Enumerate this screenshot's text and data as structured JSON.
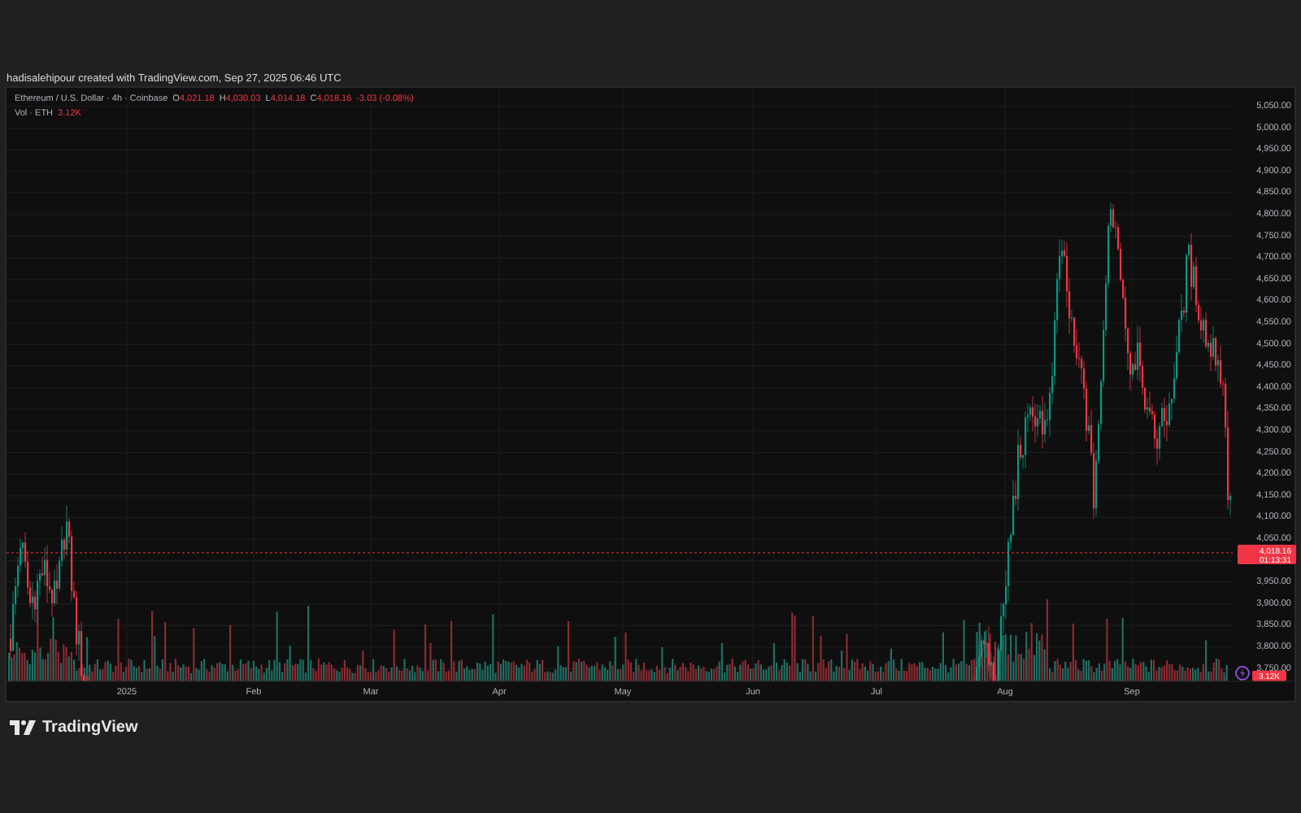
{
  "attribution": "hadisalehipour created with TradingView.com, Sep 27, 2025 06:46 UTC",
  "legend": {
    "symbol": "Ethereum / U.S. Dollar · 4h · Coinbase",
    "ohlc": [
      {
        "label": "O",
        "value": "4,021.18"
      },
      {
        "label": "H",
        "value": "4,030.03"
      },
      {
        "label": "L",
        "value": "4,014.18"
      },
      {
        "label": "C",
        "value": "4,018.16"
      }
    ],
    "change": "-3.03 (-0.08%)",
    "volume_label": "Vol · ETH",
    "volume_value": "3.12K"
  },
  "price_axis_upper": [
    "5,050.00",
    "5,000.00",
    "4,950.00",
    "4,900.00",
    "4,850.00",
    "4,800.00",
    "4,750.00",
    "4,700.00",
    "4,650.00",
    "4,600.00",
    "4,550.00",
    "4,500.00",
    "4,450.00",
    "4,400.00",
    "4,350.00",
    "4,300.00",
    "4,250.00",
    "4,200.00",
    "4,150.00",
    "4,100.00",
    "4,050.00"
  ],
  "price_axis_lower": [
    "3,950.00",
    "3,900.00",
    "3,850.00",
    "3,800.00",
    "3,750.00"
  ],
  "last_price": {
    "price": "4,018.16",
    "countdown": "01:13:31"
  },
  "volume_badge": "3.12K",
  "time_axis": [
    "2025",
    "Feb",
    "Mar",
    "Apr",
    "May",
    "Jun",
    "Jul",
    "Aug",
    "Sep"
  ],
  "brand": "TradingView"
}
